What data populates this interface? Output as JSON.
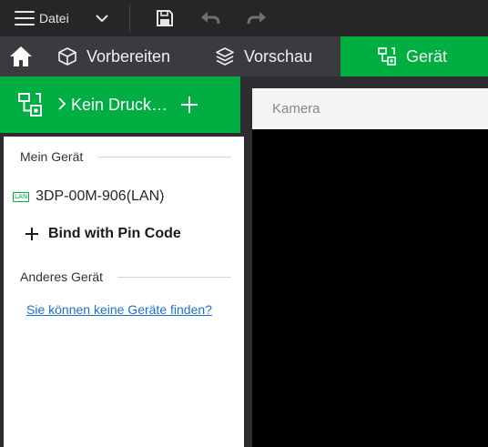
{
  "menubar": {
    "file_label": "Datei",
    "icons": [
      "hamburger-icon",
      "chevron-down-icon",
      "save-icon",
      "undo-icon",
      "redo-icon"
    ]
  },
  "tabs": {
    "home_icon": "home-icon",
    "prepare": "Vorbereiten",
    "preview": "Vorschau",
    "device": "Gerät",
    "active": "device"
  },
  "left_panel": {
    "printer_name": "Kein Druck…",
    "my_device_heading": "Mein Gerät",
    "devices": [
      {
        "badge": "LAN",
        "name": "3DP-00M-906(LAN)"
      }
    ],
    "bind_label": "Bind with Pin Code",
    "other_device_heading": "Anderes Gerät",
    "help_link": "Sie können keine Geräte finden?"
  },
  "camera": {
    "title": "Kamera"
  },
  "colors": {
    "accent": "#00ae42",
    "menubar_bg": "#262629",
    "tabbar_bg": "#3b3b3f",
    "link": "#1a6fd6",
    "camera_bg": "#000000"
  }
}
